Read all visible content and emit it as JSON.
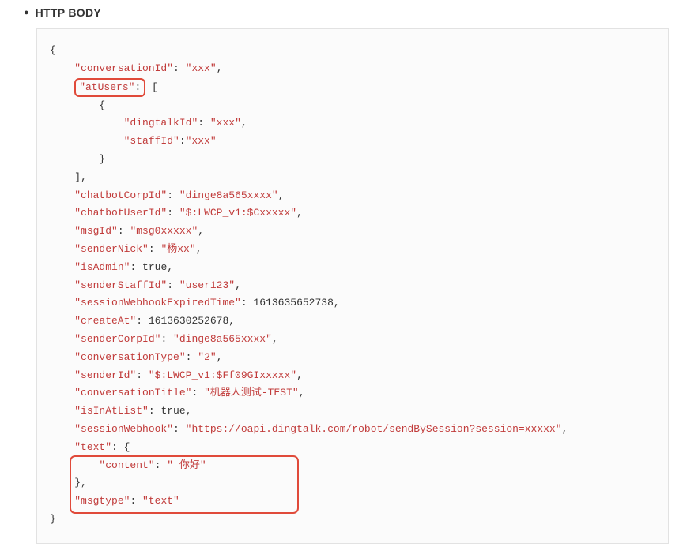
{
  "heading": "HTTP BODY",
  "json_payload": {
    "conversationId": "xxx",
    "atUsers": [
      {
        "dingtalkId": "xxx",
        "staffId": "xxx"
      }
    ],
    "chatbotCorpId": "dinge8a565xxxx",
    "chatbotUserId": "$:LWCP_v1:$Cxxxxx",
    "msgId": "msg0xxxxx",
    "senderNick": "杨xx",
    "isAdmin": true,
    "senderStaffId": "user123",
    "sessionWebhookExpiredTime": 1613635652738,
    "createAt": 1613630252678,
    "senderCorpId": "dinge8a565xxxx",
    "conversationType": "2",
    "senderId": "$:LWCP_v1:$Ff09GIxxxxx",
    "conversationTitle": "机器人测试-TEST",
    "isInAtList": true,
    "sessionWebhook": "https://oapi.dingtalk.com/robot/sendBySession?session=xxxxx",
    "text": {
      "content": " 你好"
    },
    "msgtype": "text"
  },
  "highlights": [
    "atUsers",
    "text"
  ],
  "keys": {
    "conversationId": "\"conversationId\"",
    "atUsers": "\"atUsers\"",
    "dingtalkId": "\"dingtalkId\"",
    "staffId": "\"staffId\"",
    "chatbotCorpId": "\"chatbotCorpId\"",
    "chatbotUserId": "\"chatbotUserId\"",
    "msgId": "\"msgId\"",
    "senderNick": "\"senderNick\"",
    "isAdmin": "\"isAdmin\"",
    "senderStaffId": "\"senderStaffId\"",
    "sessionWebhookExpiredTime": "\"sessionWebhookExpiredTime\"",
    "createAt": "\"createAt\"",
    "senderCorpId": "\"senderCorpId\"",
    "conversationType": "\"conversationType\"",
    "senderId": "\"senderId\"",
    "conversationTitle": "\"conversationTitle\"",
    "isInAtList": "\"isInAtList\"",
    "sessionWebhook": "\"sessionWebhook\"",
    "text": "\"text\"",
    "content": "\"content\"",
    "msgtype": "\"msgtype\""
  },
  "vals": {
    "conversationId": "\"xxx\"",
    "dingtalkId": "\"xxx\"",
    "staffId": "\"xxx\"",
    "chatbotCorpId": "\"dinge8a565xxxx\"",
    "chatbotUserId": "\"$:LWCP_v1:$Cxxxxx\"",
    "msgId": "\"msg0xxxxx\"",
    "senderNick": "\"杨xx\"",
    "isAdmin": "true",
    "senderStaffId": "\"user123\"",
    "sessionWebhookExpiredTime": "1613635652738",
    "createAt": "1613630252678",
    "senderCorpId": "\"dinge8a565xxxx\"",
    "conversationType": "\"2\"",
    "senderId": "\"$:LWCP_v1:$Ff09GIxxxxx\"",
    "conversationTitle": "\"机器人测试-TEST\"",
    "isInAtList": "true",
    "sessionWebhook": "\"https://oapi.dingtalk.com/robot/sendBySession?session=xxxxx\"",
    "content": "\" 你好\"",
    "msgtype": "\"text\""
  }
}
